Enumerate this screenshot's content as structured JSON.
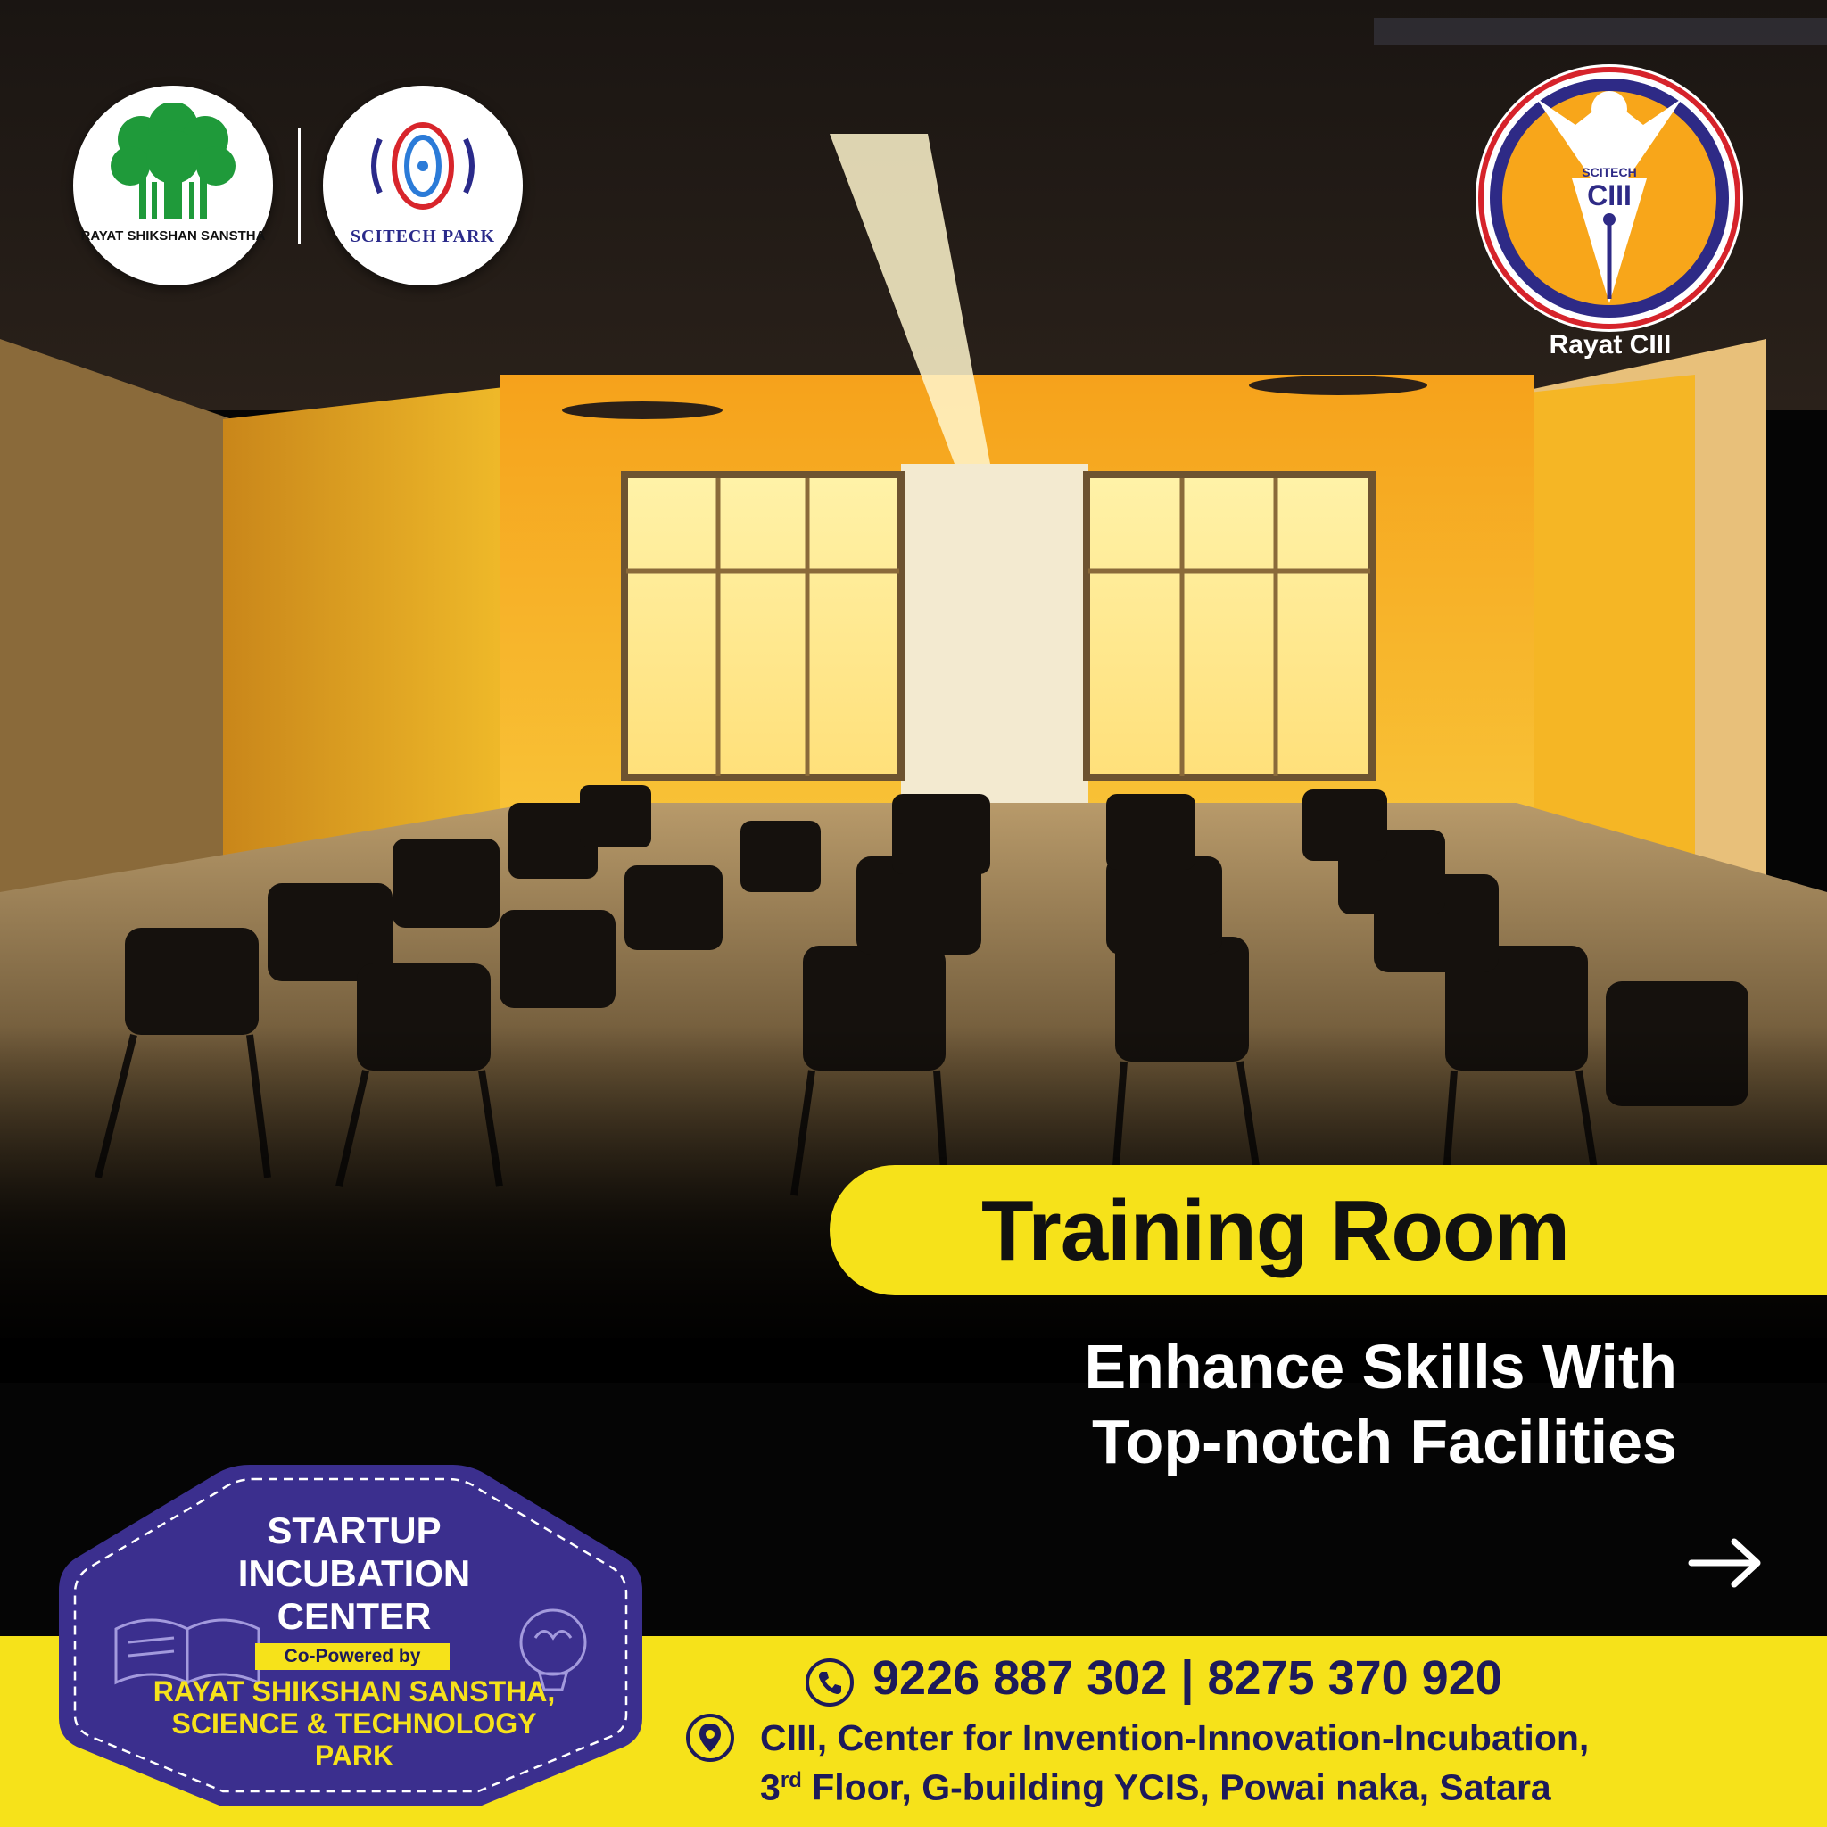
{
  "logos": {
    "rayat": "RAYAT SHIKSHAN SANSTHA",
    "scitech": "SCITECH PARK",
    "ciii_badge_small": "SCITECH",
    "ciii_badge_big": "CIII",
    "ciii_caption": "Rayat CIII"
  },
  "headline": {
    "title": "Training Room",
    "subtitle_line1": "Enhance Skills With",
    "subtitle_line2": "Top-notch Facilities"
  },
  "badge": {
    "line1": "STARTUP",
    "line2": "INCUBATION",
    "line3": "CENTER",
    "co_powered": "Co-Powered by",
    "org_line1": "RAYAT SHIKSHAN SANSTHA,",
    "org_line2": "SCIENCE & TECHNOLOGY",
    "org_line3": "PARK"
  },
  "contact": {
    "phones": "9226 887 302 | 8275 370 920",
    "address_line1": "CIII, Center for Invention-Innovation-Incubation,",
    "address_floor_num": "3",
    "address_floor_sup": "rd",
    "address_line2_rest": " Floor, G-building YCIS, Powai naka, Satara"
  },
  "icons": {
    "phone": "phone-icon",
    "location": "location-pin-icon",
    "arrow": "arrow-right-icon",
    "book": "open-book-icon",
    "brain": "brain-bulb-icon"
  },
  "colors": {
    "accent_yellow": "#f6e21a",
    "badge_purple": "#3b2f8e",
    "text_navy": "#1d1a5a",
    "wall_orange": "#f7a51c",
    "wall_yellow": "#f5c21b"
  }
}
